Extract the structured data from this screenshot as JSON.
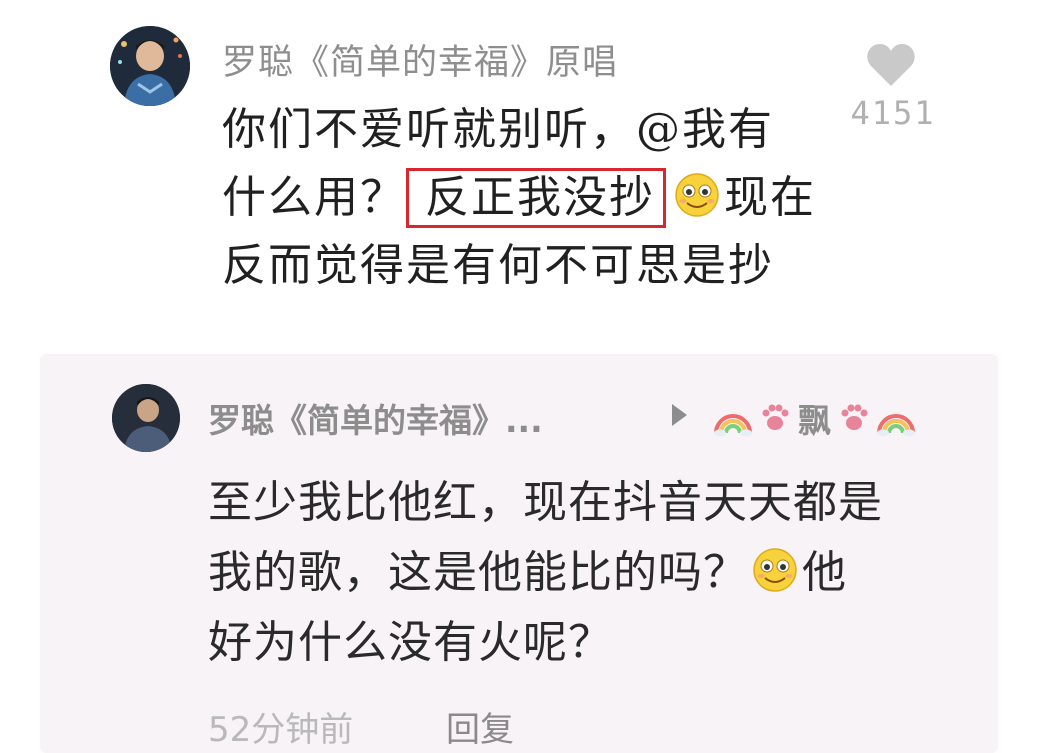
{
  "comment": {
    "author": "罗聪《简单的幸福》原唱",
    "like_count": "4151",
    "line1": "你们不爱听就别听，@我有",
    "line2_prefix": "什么用？",
    "line2_highlight": "反正我没抄",
    "line2_suffix": "现在",
    "line3": "反而觉得是有何不可思是抄",
    "emoji": "smile-emoji"
  },
  "reply": {
    "author": "罗聪《简单的幸福》...",
    "target_text": "飘",
    "target_icons": [
      "rainbow-icon",
      "paw-icon",
      "paw-icon",
      "rainbow-icon"
    ],
    "line1": "至少我比他红，现在抖音天天都是",
    "line2_prefix": "我的歌，这是他能比的吗？",
    "line2_suffix": "他",
    "line3": "好为什么没有火呢？",
    "emoji": "smile-emoji",
    "time": "52分钟前",
    "reply_label": "回复"
  },
  "colors": {
    "highlight_border": "#d9262f",
    "reply_background": "#f8f3f6",
    "muted_text": "#8d8d8d"
  }
}
